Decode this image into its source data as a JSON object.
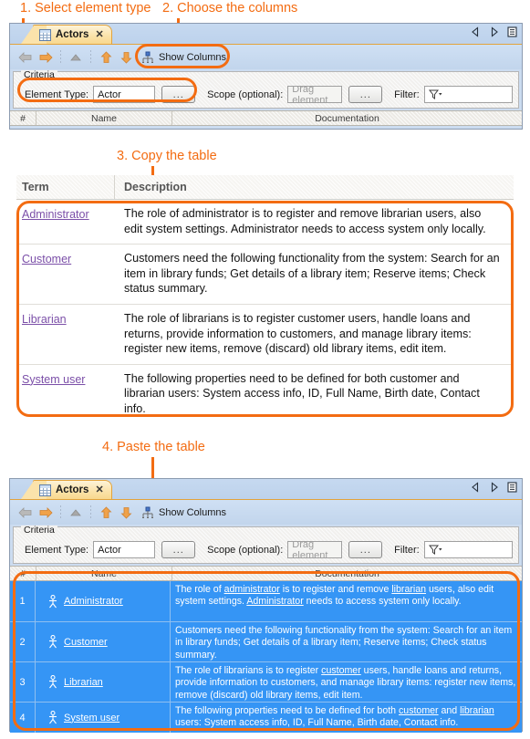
{
  "callouts": {
    "step1": "1. Select element type",
    "step2": "2. Choose the columns",
    "step3": "3. Copy the table",
    "step4": "4. Paste the table"
  },
  "top_panel": {
    "tab": {
      "label": "Actors",
      "icon": "table-icon",
      "close": "✕"
    },
    "tabstrip_right": {
      "prev": "nav-left-icon",
      "next": "nav-right-icon",
      "menu": "tab-list-icon"
    },
    "toolbar": {
      "back": "back-arrow-icon",
      "forward": "forward-arrow-icon",
      "up": "up-triangle-icon",
      "move_up": "move-up-icon",
      "move_down": "move-down-icon",
      "show_columns_label": "Show Columns",
      "show_columns_icon": "columns-icon"
    },
    "criteria": {
      "legend": "Criteria",
      "element_type_label": "Element Type:",
      "element_type_value": "Actor",
      "element_type_browse": "...",
      "scope_label": "Scope (optional):",
      "scope_placeholder": "Drag element",
      "scope_browse": "...",
      "filter_label": "Filter:",
      "filter_icon": "funnel-dropdown-icon"
    },
    "columns": [
      "#",
      "Name",
      "Documentation"
    ]
  },
  "doc_table": {
    "headers": [
      "Term",
      "Description"
    ],
    "rows": [
      {
        "term": "Administrator",
        "description": "The role of administrator is to register and remove librarian users, also edit system settings. Administrator needs to access system only locally."
      },
      {
        "term": "Customer",
        "description": "Customers need the following functionality from the system: Search for an item in library funds; Get details of a library item; Reserve items; Check status summary."
      },
      {
        "term": "Librarian",
        "description": "The role of librarians is to register customer users, handle loans and returns, provide information to customers, and manage library items: register new items, remove (discard) old library items, edit item."
      },
      {
        "term": "System user",
        "description": "The following properties need to be defined for both customer and librarian users: System access info, ID, Full Name, Birth date, Contact info."
      }
    ]
  },
  "bottom_panel": {
    "tab": {
      "label": "Actors",
      "icon": "table-icon",
      "close": "✕"
    },
    "tabstrip_right": {
      "prev": "nav-left-icon",
      "next": "nav-right-icon",
      "menu": "tab-list-icon"
    },
    "toolbar": {
      "back": "back-arrow-icon",
      "forward": "forward-arrow-icon",
      "up": "up-triangle-icon",
      "move_up": "move-up-icon",
      "move_down": "move-down-icon",
      "show_columns_label": "Show Columns",
      "show_columns_icon": "columns-icon"
    },
    "criteria": {
      "legend": "Criteria",
      "element_type_label": "Element Type:",
      "element_type_value": "Actor",
      "element_type_browse": "...",
      "scope_label": "Scope (optional):",
      "scope_placeholder": "Drag element",
      "scope_browse": "...",
      "filter_label": "Filter:",
      "filter_icon": "funnel-dropdown-icon"
    },
    "columns": [
      "#",
      "Name",
      "Documentation"
    ],
    "rows": [
      {
        "num": "1",
        "name": "Administrator",
        "icon": "actor-icon",
        "doc_html": "The role of <u>administrator</u> is to register and remove <u>librarian</u> users, also edit system settings. <u>Administrator</u> needs to access system only locally."
      },
      {
        "num": "2",
        "name": "Customer",
        "icon": "actor-icon",
        "doc_html": "Customers need the following functionality from the system: Search for an item in library funds; Get details of a library item; Reserve items; Check status summary."
      },
      {
        "num": "3",
        "name": "Librarian",
        "icon": "actor-icon",
        "doc_html": "The role of librarians is to register <u>customer</u> users, handle loans and returns, provide information to customers, and manage library items: register new items, remove (discard) old library items, edit item."
      },
      {
        "num": "4",
        "name": "System user",
        "icon": "actor-icon",
        "doc_html": "The following properties need to be defined for both <u>customer</u> and <u>librarian</u> users: System access info, ID, Full Name, Birth date, Contact info."
      }
    ]
  },
  "colors": {
    "accent": "#f36c12",
    "selection": "#3595f5",
    "link": "#7b4fa8",
    "tab_gold": "#fbe3ab",
    "panel_blue": "#c6d9f0"
  }
}
